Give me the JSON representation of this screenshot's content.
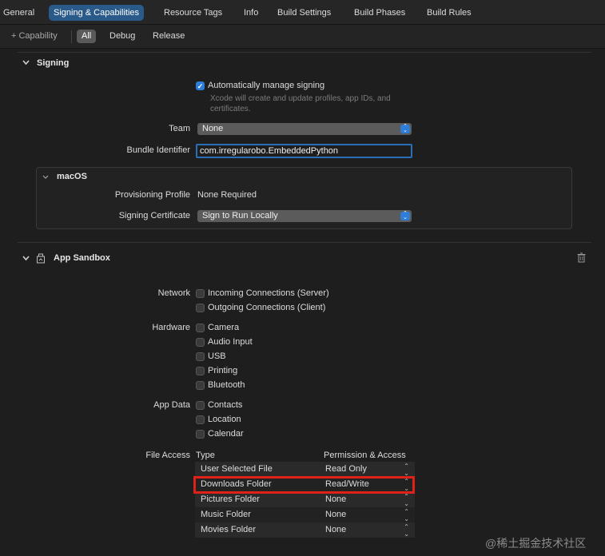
{
  "tabs": [
    "General",
    "Signing & Capabilities",
    "Resource Tags",
    "Info",
    "Build Settings",
    "Build Phases",
    "Build Rules"
  ],
  "active_tab": "Signing & Capabilities",
  "filter": {
    "add_capability": "+ Capability",
    "segments": [
      "All",
      "Debug",
      "Release"
    ],
    "selected": "All"
  },
  "signing": {
    "title": "Signing",
    "auto_manage_label": "Automatically manage signing",
    "auto_manage_checked": true,
    "auto_manage_hint": "Xcode will create and update profiles, app IDs, and certificates.",
    "team_label": "Team",
    "team_value": "None",
    "bundle_id_label": "Bundle Identifier",
    "bundle_id_value": "com.irregularobo.EmbeddedPython",
    "macos": {
      "title": "macOS",
      "prov_profile_label": "Provisioning Profile",
      "prov_profile_value": "None Required",
      "sign_cert_label": "Signing Certificate",
      "sign_cert_value": "Sign to Run Locally"
    }
  },
  "sandbox": {
    "title": "App Sandbox",
    "network_label": "Network",
    "network_items": [
      "Incoming Connections (Server)",
      "Outgoing Connections (Client)"
    ],
    "hardware_label": "Hardware",
    "hardware_items": [
      "Camera",
      "Audio Input",
      "USB",
      "Printing",
      "Bluetooth"
    ],
    "appdata_label": "App Data",
    "appdata_items": [
      "Contacts",
      "Location",
      "Calendar"
    ],
    "file_access": {
      "label": "File Access",
      "col_type": "Type",
      "col_perm": "Permission & Access",
      "rows": [
        {
          "type": "User Selected File",
          "perm": "Read Only"
        },
        {
          "type": "Downloads Folder",
          "perm": "Read/Write"
        },
        {
          "type": "Pictures Folder",
          "perm": "None"
        },
        {
          "type": "Music Folder",
          "perm": "None"
        },
        {
          "type": "Movies Folder",
          "perm": "None"
        }
      ],
      "highlighted_row": "Downloads Folder",
      "highlight_color": "#e0211a"
    }
  },
  "watermark": "@稀土掘金技术社区",
  "colors": {
    "accent": "#2e7dd8",
    "active_tab": "#2a5a8a"
  }
}
